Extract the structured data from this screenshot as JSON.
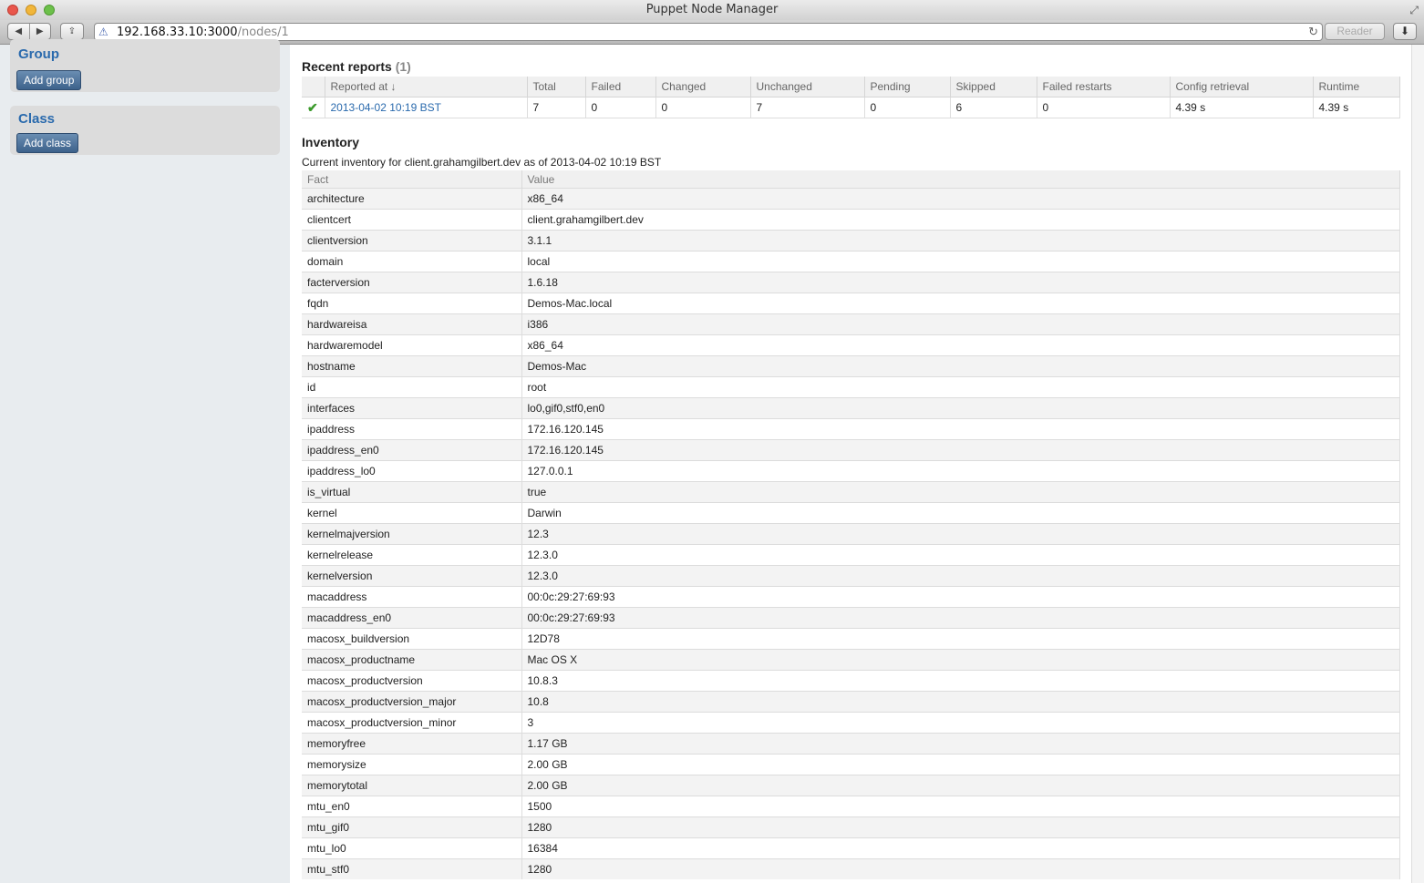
{
  "window": {
    "title": "Puppet Node Manager"
  },
  "toolbar": {
    "back": "◀",
    "forward": "▶",
    "url_host": "192.168.33.10:3000",
    "url_path": "/nodes/1",
    "reader": "Reader"
  },
  "sidebar": {
    "group": {
      "title": "Group",
      "button": "Add group"
    },
    "class": {
      "title": "Class",
      "button": "Add class"
    }
  },
  "recent_reports": {
    "title": "Recent reports",
    "count": "(1)",
    "columns": [
      "",
      "Reported at ↓",
      "Total",
      "Failed",
      "Changed",
      "Unchanged",
      "Pending",
      "Skipped",
      "Failed restarts",
      "Config retrieval",
      "Runtime"
    ],
    "rows": [
      {
        "reported_at": "2013-04-02 10:19 BST",
        "total": "7",
        "failed": "0",
        "changed": "0",
        "unchanged": "7",
        "pending": "0",
        "skipped": "6",
        "failed_restarts": "0",
        "config_retrieval": "4.39 s",
        "runtime": "4.39 s"
      }
    ]
  },
  "inventory": {
    "title": "Inventory",
    "caption": "Current inventory for client.grahamgilbert.dev as of 2013-04-02 10:19 BST",
    "columns": [
      "Fact",
      "Value"
    ],
    "rows": [
      [
        "architecture",
        "x86_64"
      ],
      [
        "clientcert",
        "client.grahamgilbert.dev"
      ],
      [
        "clientversion",
        "3.1.1"
      ],
      [
        "domain",
        "local"
      ],
      [
        "facterversion",
        "1.6.18"
      ],
      [
        "fqdn",
        "Demos-Mac.local"
      ],
      [
        "hardwareisa",
        "i386"
      ],
      [
        "hardwaremodel",
        "x86_64"
      ],
      [
        "hostname",
        "Demos-Mac"
      ],
      [
        "id",
        "root"
      ],
      [
        "interfaces",
        "lo0,gif0,stf0,en0"
      ],
      [
        "ipaddress",
        "172.16.120.145"
      ],
      [
        "ipaddress_en0",
        "172.16.120.145"
      ],
      [
        "ipaddress_lo0",
        "127.0.0.1"
      ],
      [
        "is_virtual",
        "true"
      ],
      [
        "kernel",
        "Darwin"
      ],
      [
        "kernelmajversion",
        "12.3"
      ],
      [
        "kernelrelease",
        "12.3.0"
      ],
      [
        "kernelversion",
        "12.3.0"
      ],
      [
        "macaddress",
        "00:0c:29:27:69:93"
      ],
      [
        "macaddress_en0",
        "00:0c:29:27:69:93"
      ],
      [
        "macosx_buildversion",
        "12D78"
      ],
      [
        "macosx_productname",
        "Mac OS X"
      ],
      [
        "macosx_productversion",
        "10.8.3"
      ],
      [
        "macosx_productversion_major",
        "10.8"
      ],
      [
        "macosx_productversion_minor",
        "3"
      ],
      [
        "memoryfree",
        "1.17 GB"
      ],
      [
        "memorysize",
        "2.00 GB"
      ],
      [
        "memorytotal",
        "2.00 GB"
      ],
      [
        "mtu_en0",
        "1500"
      ],
      [
        "mtu_gif0",
        "1280"
      ],
      [
        "mtu_lo0",
        "16384"
      ],
      [
        "mtu_stf0",
        "1280"
      ]
    ]
  }
}
